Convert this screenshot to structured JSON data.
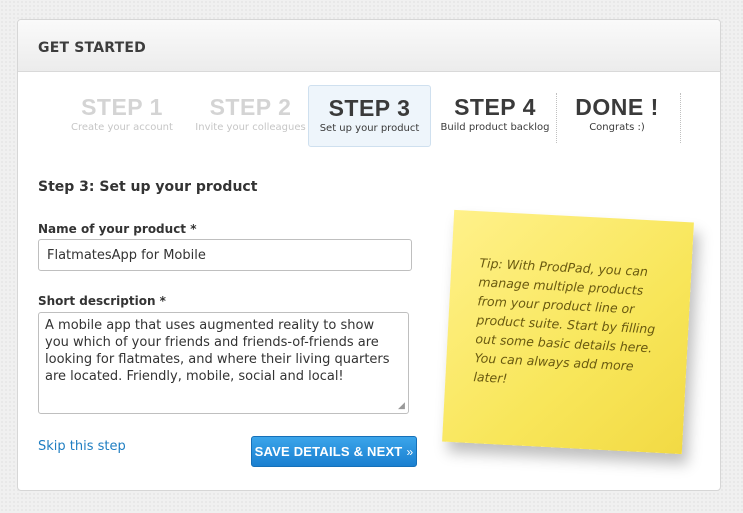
{
  "header": {
    "title": "GET STARTED"
  },
  "steps": [
    {
      "num": "STEP 1",
      "sub": "Create your account",
      "state": "past"
    },
    {
      "num": "STEP 2",
      "sub": "Invite your colleagues",
      "state": "past"
    },
    {
      "num": "STEP 3",
      "sub": "Set up your product",
      "state": "current"
    },
    {
      "num": "STEP 4",
      "sub": "Build product backlog",
      "state": "future"
    },
    {
      "num": "DONE !",
      "sub": "Congrats :)",
      "state": "future"
    }
  ],
  "form": {
    "section_title": "Step 3: Set up your product",
    "name_label": "Name of your product *",
    "name_value": "FlatmatesApp for Mobile",
    "desc_label": "Short description *",
    "desc_value": "A mobile app that uses augmented reality to show you which of your friends and friends-of-friends are looking for flatmates, and where their living quarters are located. Friendly, mobile, social and local!",
    "skip_link": "Skip this step",
    "save_button": "SAVE DETAILS & NEXT",
    "save_arrow": "»"
  },
  "tip": {
    "text": "Tip: With ProdPad, you can manage multiple products from your product line or product suite. Start by filling out some basic details here. You can always add more later!"
  },
  "colors": {
    "accent": "#1f7ec2",
    "button": "#2a92de",
    "current_step_bg": "#eef5fb",
    "note": "#f8e65a"
  }
}
